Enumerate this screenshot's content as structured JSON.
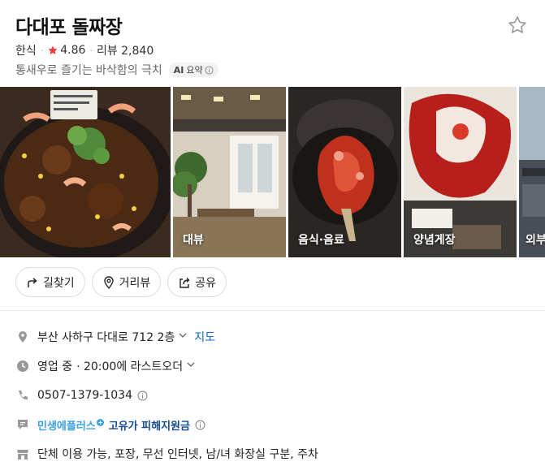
{
  "place": {
    "name": "다대포 돌짜장",
    "category": "한식",
    "rating": "4.86",
    "review_label": "리뷰 2,840",
    "tagline": "통새우로 즐기는 바삭함의 극치",
    "ai_badge": {
      "prefix": "AI",
      "label": "요약"
    }
  },
  "photos": [
    {
      "label": "",
      "theme": "food-main"
    },
    {
      "label": "대뷰",
      "theme": "interior"
    },
    {
      "label": "음식·음료",
      "theme": "food"
    },
    {
      "label": "양념게장",
      "theme": "crab"
    },
    {
      "label": "외부",
      "theme": "exterior"
    }
  ],
  "actions": [
    {
      "label": "길찾기",
      "icon": "directions-icon"
    },
    {
      "label": "거리뷰",
      "icon": "map-pin-icon"
    },
    {
      "label": "공유",
      "icon": "share-icon"
    }
  ],
  "info": {
    "address": "부산 사하구 다대로 712 2층",
    "map_link": "지도",
    "status": "영업 중",
    "hours_detail": "· 20:00에 라스트오더",
    "phone": "0507-1379-1034",
    "benefit_brand": "민생에플러스",
    "benefit_text": "고유가 피해지원금",
    "amenities": "단체 이용 가능, 포장, 무선 인터넷, 남/녀 화장실 구분, 주차"
  },
  "colors": {
    "star": "#f23d3d",
    "link": "#0a67d6",
    "brand": "#3aa0e0"
  }
}
